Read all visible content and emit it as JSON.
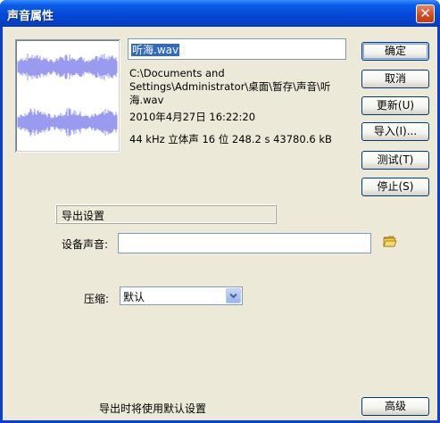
{
  "window": {
    "title": "声音属性",
    "close_label": "✕"
  },
  "file": {
    "name": "听海.wav",
    "path": "C:\\Documents and Settings\\Administrator\\桌面\\暂存\\声音\\听海.wav",
    "date": "2010年4月27日  16:22:20",
    "format": "44 kHz 立体声 16 位 248.2 s 43780.6 kB"
  },
  "buttons": {
    "ok": "确定",
    "cancel": "取消",
    "update": "更新(U)",
    "import": "导入(I)...",
    "test": "测试(T)",
    "stop": "停止(S)",
    "advanced": "高级"
  },
  "export": {
    "section_title": "导出设置",
    "device_sound_label": "设备声音:",
    "device_sound_value": "",
    "compression_label": "压缩:",
    "compression_value": "默认",
    "note": "导出时将使用默认设置"
  },
  "colors": {
    "titlebar": "#0348d6",
    "dialog_bg": "#ece9d8",
    "waveform": "#9a9af0",
    "selection": "#316ac5"
  },
  "icons": {
    "close": "close-icon",
    "folder": "folder-icon",
    "dropdown": "chevron-down-icon"
  }
}
